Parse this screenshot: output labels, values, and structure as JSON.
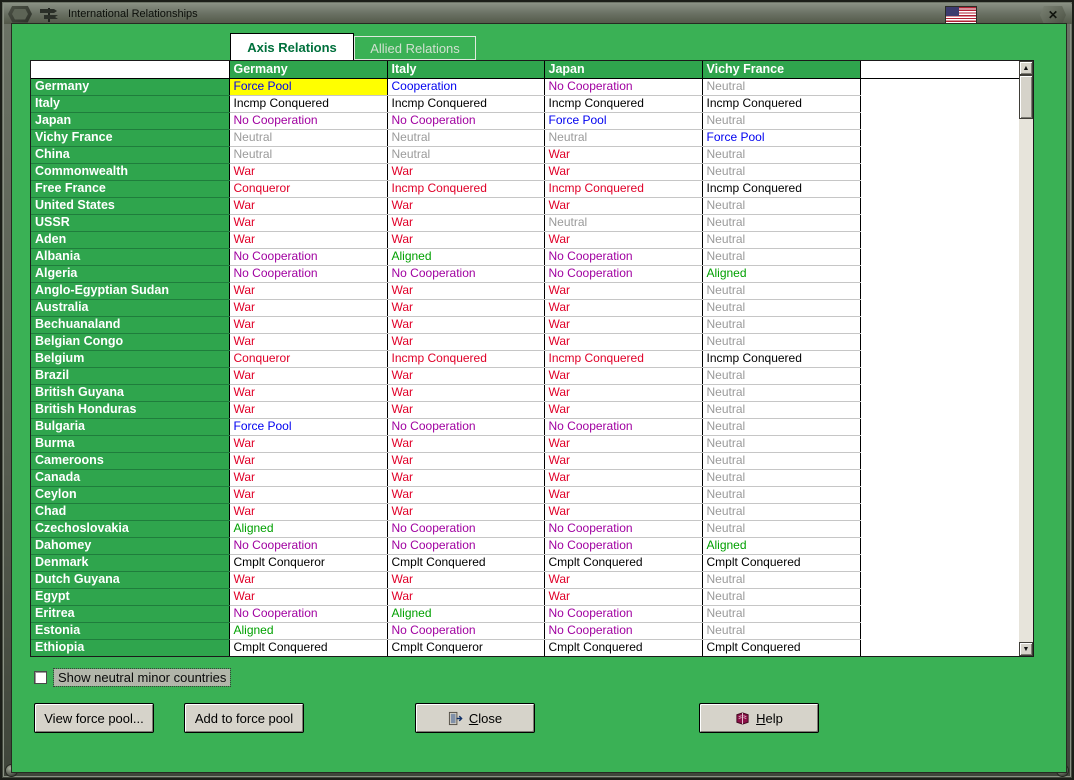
{
  "window": {
    "title": "International Relationships"
  },
  "icons": {
    "close_x": "✕",
    "scroll_up": "▲",
    "scroll_down": "▼"
  },
  "colors": {
    "window_bg": "#3ab155",
    "header_bg": "#2fa54d",
    "selected_cell_bg": "#ffff00"
  },
  "tabs": [
    {
      "label": "Axis Relations",
      "active": true
    },
    {
      "label": "Allied Relations",
      "active": false
    }
  ],
  "table": {
    "columns": [
      "Germany",
      "Italy",
      "Japan",
      "Vichy France"
    ],
    "status_colors": {
      "blue": "#0000f0",
      "purple": "#a000a0",
      "gray": "#9a9a9a",
      "red": "#e00028",
      "green": "#00a000",
      "black": "#000000"
    },
    "rows": [
      {
        "country": "Germany",
        "cells": [
          {
            "t": "Force Pool",
            "c": "blue",
            "sel": true
          },
          {
            "t": "Cooperation",
            "c": "blue"
          },
          {
            "t": "No Cooperation",
            "c": "purple"
          },
          {
            "t": "Neutral",
            "c": "gray"
          }
        ]
      },
      {
        "country": "Italy",
        "cells": [
          {
            "t": "Incmp Conquered",
            "c": "black"
          },
          {
            "t": "Incmp Conquered",
            "c": "black"
          },
          {
            "t": "Incmp Conquered",
            "c": "black"
          },
          {
            "t": "Incmp Conquered",
            "c": "black"
          }
        ]
      },
      {
        "country": "Japan",
        "cells": [
          {
            "t": "No Cooperation",
            "c": "purple"
          },
          {
            "t": "No Cooperation",
            "c": "purple"
          },
          {
            "t": "Force Pool",
            "c": "blue"
          },
          {
            "t": "Neutral",
            "c": "gray"
          }
        ]
      },
      {
        "country": "Vichy France",
        "cells": [
          {
            "t": "Neutral",
            "c": "gray"
          },
          {
            "t": "Neutral",
            "c": "gray"
          },
          {
            "t": "Neutral",
            "c": "gray"
          },
          {
            "t": "Force Pool",
            "c": "blue"
          }
        ]
      },
      {
        "country": "China",
        "cells": [
          {
            "t": "Neutral",
            "c": "gray"
          },
          {
            "t": "Neutral",
            "c": "gray"
          },
          {
            "t": "War",
            "c": "red"
          },
          {
            "t": "Neutral",
            "c": "gray"
          }
        ]
      },
      {
        "country": "Commonwealth",
        "cells": [
          {
            "t": "War",
            "c": "red"
          },
          {
            "t": "War",
            "c": "red"
          },
          {
            "t": "War",
            "c": "red"
          },
          {
            "t": "Neutral",
            "c": "gray"
          }
        ]
      },
      {
        "country": "Free France",
        "cells": [
          {
            "t": "Conqueror",
            "c": "red"
          },
          {
            "t": "Incmp Conquered",
            "c": "red"
          },
          {
            "t": "Incmp Conquered",
            "c": "red"
          },
          {
            "t": "Incmp Conquered",
            "c": "black"
          }
        ]
      },
      {
        "country": "United States",
        "cells": [
          {
            "t": "War",
            "c": "red"
          },
          {
            "t": "War",
            "c": "red"
          },
          {
            "t": "War",
            "c": "red"
          },
          {
            "t": "Neutral",
            "c": "gray"
          }
        ]
      },
      {
        "country": "USSR",
        "cells": [
          {
            "t": "War",
            "c": "red"
          },
          {
            "t": "War",
            "c": "red"
          },
          {
            "t": "Neutral",
            "c": "gray"
          },
          {
            "t": "Neutral",
            "c": "gray"
          }
        ]
      },
      {
        "country": "Aden",
        "cells": [
          {
            "t": "War",
            "c": "red"
          },
          {
            "t": "War",
            "c": "red"
          },
          {
            "t": "War",
            "c": "red"
          },
          {
            "t": "Neutral",
            "c": "gray"
          }
        ]
      },
      {
        "country": "Albania",
        "cells": [
          {
            "t": "No Cooperation",
            "c": "purple"
          },
          {
            "t": "Aligned",
            "c": "green"
          },
          {
            "t": "No Cooperation",
            "c": "purple"
          },
          {
            "t": "Neutral",
            "c": "gray"
          }
        ]
      },
      {
        "country": "Algeria",
        "cells": [
          {
            "t": "No Cooperation",
            "c": "purple"
          },
          {
            "t": "No Cooperation",
            "c": "purple"
          },
          {
            "t": "No Cooperation",
            "c": "purple"
          },
          {
            "t": "Aligned",
            "c": "green"
          }
        ]
      },
      {
        "country": "Anglo-Egyptian Sudan",
        "cells": [
          {
            "t": "War",
            "c": "red"
          },
          {
            "t": "War",
            "c": "red"
          },
          {
            "t": "War",
            "c": "red"
          },
          {
            "t": "Neutral",
            "c": "gray"
          }
        ]
      },
      {
        "country": "Australia",
        "cells": [
          {
            "t": "War",
            "c": "red"
          },
          {
            "t": "War",
            "c": "red"
          },
          {
            "t": "War",
            "c": "red"
          },
          {
            "t": "Neutral",
            "c": "gray"
          }
        ]
      },
      {
        "country": "Bechuanaland",
        "cells": [
          {
            "t": "War",
            "c": "red"
          },
          {
            "t": "War",
            "c": "red"
          },
          {
            "t": "War",
            "c": "red"
          },
          {
            "t": "Neutral",
            "c": "gray"
          }
        ]
      },
      {
        "country": "Belgian Congo",
        "cells": [
          {
            "t": "War",
            "c": "red"
          },
          {
            "t": "War",
            "c": "red"
          },
          {
            "t": "War",
            "c": "red"
          },
          {
            "t": "Neutral",
            "c": "gray"
          }
        ]
      },
      {
        "country": "Belgium",
        "cells": [
          {
            "t": "Conqueror",
            "c": "red"
          },
          {
            "t": "Incmp Conquered",
            "c": "red"
          },
          {
            "t": "Incmp Conquered",
            "c": "red"
          },
          {
            "t": "Incmp Conquered",
            "c": "black"
          }
        ]
      },
      {
        "country": "Brazil",
        "cells": [
          {
            "t": "War",
            "c": "red"
          },
          {
            "t": "War",
            "c": "red"
          },
          {
            "t": "War",
            "c": "red"
          },
          {
            "t": "Neutral",
            "c": "gray"
          }
        ]
      },
      {
        "country": "British Guyana",
        "cells": [
          {
            "t": "War",
            "c": "red"
          },
          {
            "t": "War",
            "c": "red"
          },
          {
            "t": "War",
            "c": "red"
          },
          {
            "t": "Neutral",
            "c": "gray"
          }
        ]
      },
      {
        "country": "British Honduras",
        "cells": [
          {
            "t": "War",
            "c": "red"
          },
          {
            "t": "War",
            "c": "red"
          },
          {
            "t": "War",
            "c": "red"
          },
          {
            "t": "Neutral",
            "c": "gray"
          }
        ]
      },
      {
        "country": "Bulgaria",
        "cells": [
          {
            "t": "Force Pool",
            "c": "blue"
          },
          {
            "t": "No Cooperation",
            "c": "purple"
          },
          {
            "t": "No Cooperation",
            "c": "purple"
          },
          {
            "t": "Neutral",
            "c": "gray"
          }
        ]
      },
      {
        "country": "Burma",
        "cells": [
          {
            "t": "War",
            "c": "red"
          },
          {
            "t": "War",
            "c": "red"
          },
          {
            "t": "War",
            "c": "red"
          },
          {
            "t": "Neutral",
            "c": "gray"
          }
        ]
      },
      {
        "country": "Cameroons",
        "cells": [
          {
            "t": "War",
            "c": "red"
          },
          {
            "t": "War",
            "c": "red"
          },
          {
            "t": "War",
            "c": "red"
          },
          {
            "t": "Neutral",
            "c": "gray"
          }
        ]
      },
      {
        "country": "Canada",
        "cells": [
          {
            "t": "War",
            "c": "red"
          },
          {
            "t": "War",
            "c": "red"
          },
          {
            "t": "War",
            "c": "red"
          },
          {
            "t": "Neutral",
            "c": "gray"
          }
        ]
      },
      {
        "country": "Ceylon",
        "cells": [
          {
            "t": "War",
            "c": "red"
          },
          {
            "t": "War",
            "c": "red"
          },
          {
            "t": "War",
            "c": "red"
          },
          {
            "t": "Neutral",
            "c": "gray"
          }
        ]
      },
      {
        "country": "Chad",
        "cells": [
          {
            "t": "War",
            "c": "red"
          },
          {
            "t": "War",
            "c": "red"
          },
          {
            "t": "War",
            "c": "red"
          },
          {
            "t": "Neutral",
            "c": "gray"
          }
        ]
      },
      {
        "country": "Czechoslovakia",
        "cells": [
          {
            "t": "Aligned",
            "c": "green"
          },
          {
            "t": "No Cooperation",
            "c": "purple"
          },
          {
            "t": "No Cooperation",
            "c": "purple"
          },
          {
            "t": "Neutral",
            "c": "gray"
          }
        ]
      },
      {
        "country": "Dahomey",
        "cells": [
          {
            "t": "No Cooperation",
            "c": "purple"
          },
          {
            "t": "No Cooperation",
            "c": "purple"
          },
          {
            "t": "No Cooperation",
            "c": "purple"
          },
          {
            "t": "Aligned",
            "c": "green"
          }
        ]
      },
      {
        "country": "Denmark",
        "cells": [
          {
            "t": "Cmplt Conqueror",
            "c": "black"
          },
          {
            "t": "Cmplt Conquered",
            "c": "black"
          },
          {
            "t": "Cmplt Conquered",
            "c": "black"
          },
          {
            "t": "Cmplt Conquered",
            "c": "black"
          }
        ]
      },
      {
        "country": "Dutch Guyana",
        "cells": [
          {
            "t": "War",
            "c": "red"
          },
          {
            "t": "War",
            "c": "red"
          },
          {
            "t": "War",
            "c": "red"
          },
          {
            "t": "Neutral",
            "c": "gray"
          }
        ]
      },
      {
        "country": "Egypt",
        "cells": [
          {
            "t": "War",
            "c": "red"
          },
          {
            "t": "War",
            "c": "red"
          },
          {
            "t": "War",
            "c": "red"
          },
          {
            "t": "Neutral",
            "c": "gray"
          }
        ]
      },
      {
        "country": "Eritrea",
        "cells": [
          {
            "t": "No Cooperation",
            "c": "purple"
          },
          {
            "t": "Aligned",
            "c": "green"
          },
          {
            "t": "No Cooperation",
            "c": "purple"
          },
          {
            "t": "Neutral",
            "c": "gray"
          }
        ]
      },
      {
        "country": "Estonia",
        "cells": [
          {
            "t": "Aligned",
            "c": "green"
          },
          {
            "t": "No Cooperation",
            "c": "purple"
          },
          {
            "t": "No Cooperation",
            "c": "purple"
          },
          {
            "t": "Neutral",
            "c": "gray"
          }
        ]
      },
      {
        "country": "Ethiopia",
        "cells": [
          {
            "t": "Cmplt Conquered",
            "c": "black"
          },
          {
            "t": "Cmplt Conqueror",
            "c": "black"
          },
          {
            "t": "Cmplt Conquered",
            "c": "black"
          },
          {
            "t": "Cmplt Conquered",
            "c": "black"
          }
        ]
      }
    ]
  },
  "footer": {
    "checkbox_label": "Show neutral minor countries",
    "checkbox_checked": false,
    "buttons": {
      "view_force_pool": "View force pool...",
      "add_to_force_pool": "Add to force pool",
      "close": "Close",
      "help": "Help"
    }
  }
}
